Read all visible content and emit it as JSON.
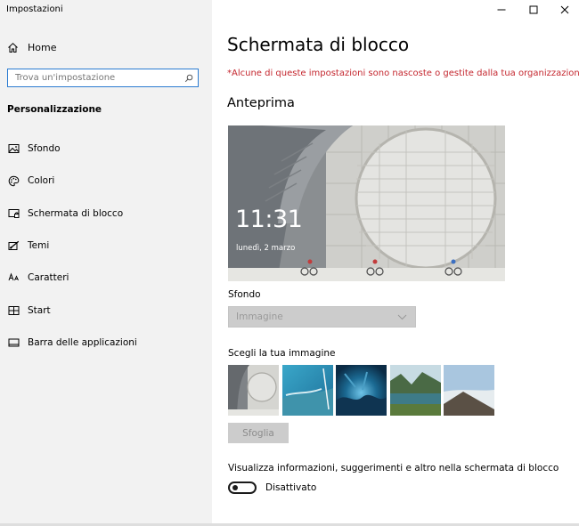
{
  "window": {
    "title": "Impostazioni",
    "controls": {
      "minimize_icon": "minimize-icon",
      "maximize_icon": "maximize-icon",
      "close_icon": "close-icon"
    }
  },
  "sidebar": {
    "home_label": "Home",
    "search": {
      "value": "",
      "placeholder": "Trova un'impostazione"
    },
    "section_title": "Personalizzazione",
    "items": [
      {
        "label": "Sfondo",
        "icon": "image-icon"
      },
      {
        "label": "Colori",
        "icon": "palette-icon"
      },
      {
        "label": "Schermata di blocco",
        "icon": "lock-screen-icon"
      },
      {
        "label": "Temi",
        "icon": "themes-icon"
      },
      {
        "label": "Caratteri",
        "icon": "fonts-icon"
      },
      {
        "label": "Start",
        "icon": "start-icon"
      },
      {
        "label": "Barra delle applicazioni",
        "icon": "taskbar-icon"
      }
    ]
  },
  "main": {
    "title": "Schermata di blocco",
    "warning": "*Alcune di queste impostazioni sono nascoste o gestite dalla tua organizzazione.",
    "preview_heading": "Anteprima",
    "preview": {
      "time": "11:31",
      "date": "lunedì, 2 marzo"
    },
    "background_label": "Sfondo",
    "background_value": "Immagine",
    "choose_image_label": "Scegli la tua immagine",
    "browse_label": "Sfoglia",
    "info_label": "Visualizza informazioni, suggerimenti e altro nella schermata di blocco",
    "toggle_state": "Disattivato"
  },
  "colors": {
    "warning": "#c4262e",
    "accent": "#2b7bd1",
    "disabled_bg": "#cccccc"
  }
}
